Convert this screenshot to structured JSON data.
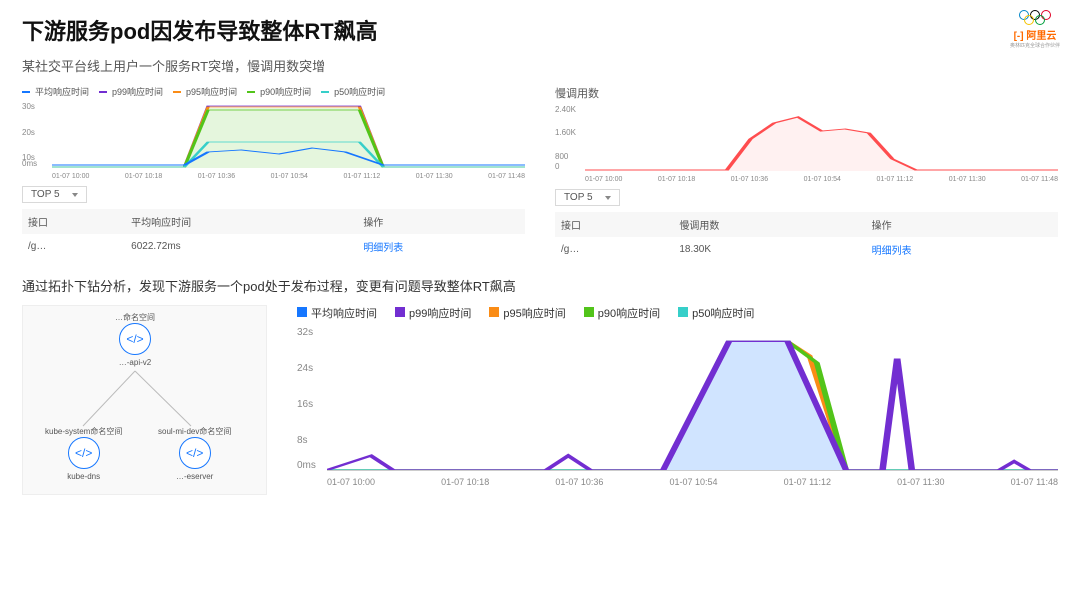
{
  "colors": {
    "blue": "#1677ff",
    "purple": "#722ed1",
    "orange": "#fa8c16",
    "green": "#52c41a",
    "cyan": "#36cfc9",
    "red": "#ff4d4f"
  },
  "header": {
    "title": "下游服务pod因发布导致整体RT飙高",
    "subtitle": "某社交平台线上用户一个服务RT突增，慢调用数突增",
    "logo": "阿里云"
  },
  "chart_data": [
    {
      "type": "line",
      "title": "",
      "series_legend": [
        "平均响应时间",
        "p99响应时间",
        "p95响应时间",
        "p90响应时间",
        "p50响应时间"
      ],
      "colors": [
        "#1677ff",
        "#722ed1",
        "#fa8c16",
        "#52c41a",
        "#36cfc9"
      ],
      "x": [
        "01-07 10:00",
        "01-07 10:18",
        "01-07 10:36",
        "01-07 10:54",
        "01-07 11:12",
        "01-07 11:30",
        "01-07 11:48"
      ],
      "yticks": [
        "0ms",
        "10s",
        "20s",
        "30s"
      ],
      "ylim": [
        0,
        30
      ],
      "series": [
        {
          "name": "p99响应时间",
          "values": [
            0,
            0,
            0,
            0,
            0,
            30,
            30,
            30,
            30,
            30,
            30,
            0,
            0,
            0,
            0,
            0,
            0
          ]
        },
        {
          "name": "p95响应时间",
          "values": [
            0,
            0,
            0,
            0,
            0,
            30,
            30,
            30,
            30,
            30,
            30,
            0,
            0,
            0,
            0,
            0,
            0
          ]
        },
        {
          "name": "p90响应时间",
          "values": [
            0,
            0,
            0,
            0,
            0,
            27,
            27,
            27,
            27,
            27,
            27,
            0,
            0,
            0,
            0,
            0,
            0
          ]
        },
        {
          "name": "p50响应时间",
          "values": [
            0,
            0,
            0,
            0,
            0,
            12,
            12,
            12,
            12,
            12,
            12,
            0,
            0,
            0,
            0,
            0,
            0
          ]
        },
        {
          "name": "平均响应时间",
          "values": [
            1,
            1,
            1,
            1,
            1,
            8,
            10,
            8,
            7,
            10,
            9,
            1,
            1,
            1,
            1,
            1,
            1
          ]
        }
      ]
    },
    {
      "type": "line",
      "title": "慢调用数",
      "x": [
        "01-07 10:00",
        "01-07 10:18",
        "01-07 10:36",
        "01-07 10:54",
        "01-07 11:12",
        "01-07 11:30",
        "01-07 11:48"
      ],
      "yticks": [
        "0",
        "800",
        "1.60K",
        "2.40K"
      ],
      "ylim": [
        0,
        2400
      ],
      "series": [
        {
          "name": "慢调用数",
          "color": "#ff4d4f",
          "values": [
            0,
            0,
            0,
            0,
            0,
            1200,
            1800,
            2100,
            1500,
            1600,
            1200,
            400,
            0,
            0,
            0,
            0,
            0
          ]
        }
      ]
    },
    {
      "type": "line",
      "title": "",
      "series_legend": [
        "平均响应时间",
        "p99响应时间",
        "p95响应时间",
        "p90响应时间",
        "p50响应时间"
      ],
      "colors": [
        "#1677ff",
        "#722ed1",
        "#fa8c16",
        "#52c41a",
        "#36cfc9"
      ],
      "x": [
        "01-07 10:00",
        "01-07 10:18",
        "01-07 10:36",
        "01-07 10:54",
        "01-07 11:12",
        "01-07 11:30",
        "01-07 11:48"
      ],
      "yticks": [
        "0ms",
        "8s",
        "16s",
        "24s",
        "32s"
      ],
      "ylim": [
        0,
        32
      ],
      "series": [
        {
          "name": "p99响应时间",
          "values": [
            0,
            3,
            0,
            0,
            0,
            0,
            4,
            0,
            0,
            0,
            30,
            30,
            0,
            0,
            26,
            0,
            0,
            2,
            0
          ]
        },
        {
          "name": "p95响应时间",
          "values": [
            0,
            0,
            0,
            0,
            0,
            0,
            0,
            0,
            0,
            0,
            30,
            30,
            0,
            0,
            0,
            0,
            0,
            0,
            0
          ]
        },
        {
          "name": "p90响应时间",
          "values": [
            0,
            0,
            0,
            0,
            0,
            0,
            0,
            0,
            0,
            0,
            30,
            30,
            0,
            0,
            0,
            0,
            0,
            0,
            0
          ]
        },
        {
          "name": "p50响应时间",
          "values": [
            0,
            0,
            0,
            0,
            0,
            0,
            0,
            0,
            0,
            0,
            30,
            30,
            0,
            0,
            0,
            0,
            0,
            0,
            0
          ]
        },
        {
          "name": "平均响应时间",
          "values": [
            0,
            0,
            0,
            0,
            0,
            0,
            0,
            0,
            0,
            0,
            30,
            30,
            0,
            0,
            0,
            0,
            0,
            0,
            0
          ]
        }
      ]
    }
  ],
  "top_select": "TOP 5",
  "left_table": {
    "headers": [
      "接口",
      "平均响应时间",
      "操作"
    ],
    "rows": [
      {
        "api": "/g…",
        "value": "6022.72ms",
        "action": "明细列表"
      }
    ]
  },
  "right_table": {
    "headers": [
      "接口",
      "慢调用数",
      "操作"
    ],
    "rows": [
      {
        "api": "/g…",
        "value": "18.30K",
        "action": "明细列表"
      }
    ]
  },
  "mid_text": "通过拓扑下钻分析，发现下游服务一个pod处于发布过程，变更有问题导致整体RT飙高",
  "topology": {
    "nodes": [
      {
        "ns": "…命名空间",
        "name": "…-api-v2"
      },
      {
        "ns": "kube-system命名空间",
        "name": "kube-dns"
      },
      {
        "ns": "soul-mi-dev命名空间",
        "name": "…-eserver"
      }
    ]
  }
}
